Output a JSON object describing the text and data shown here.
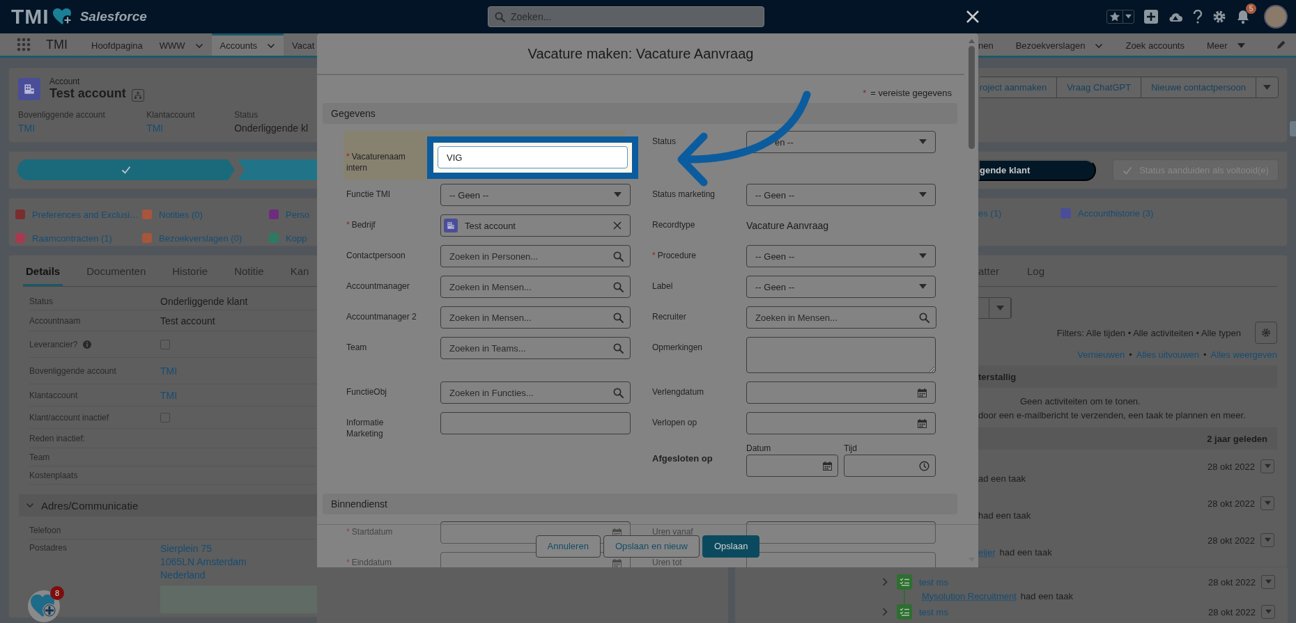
{
  "header": {
    "logo": "TMI",
    "brand": "Salesforce",
    "search": {
      "placeholder": "Zoeken..."
    },
    "notifications": "5"
  },
  "nav_left": {
    "app": "TMI",
    "items": [
      {
        "label": "Hoofdpagina",
        "kind": "link",
        "selected": false
      },
      {
        "label": "WWW",
        "kind": "menu",
        "selected": false
      },
      {
        "label": "Accounts",
        "kind": "menu",
        "selected": true
      },
      {
        "label": "Vacat",
        "kind": "link",
        "selected": false
      }
    ]
  },
  "nav_right": {
    "items": [
      {
        "label": "nen",
        "kind": "link",
        "selected": false
      },
      {
        "label": "Bezoekverslagen",
        "kind": "menu",
        "selected": false
      },
      {
        "label": "Zoek accounts",
        "kind": "link",
        "selected": false
      },
      {
        "label": "Meer",
        "kind": "more",
        "selected": false
      }
    ]
  },
  "account": {
    "type": "Account",
    "name": "Test account",
    "fields": [
      {
        "label": "Bovenliggende account",
        "value": "TMI",
        "link": true
      },
      {
        "label": "Klantaccount",
        "value": "TMI",
        "link": true
      },
      {
        "label": "Status",
        "value": "Onderliggende kl",
        "link": false
      }
    ]
  },
  "actions": [
    {
      "label": "roject aanmaken"
    },
    {
      "label": "Vraag ChatGPT"
    },
    {
      "label": "Nieuwe contactpersoon"
    }
  ],
  "path": {
    "steps": [
      {
        "complete": true
      },
      {
        "complete": false
      }
    ],
    "buttons": [
      {
        "label": "gende klant",
        "disabled": false
      },
      {
        "label": "Status aanduiden als voltooid(e)",
        "disabled": true
      }
    ]
  },
  "related": {
    "left": [
      {
        "label": "Preferences and Exclusi…",
        "color": "#7a2d2d"
      },
      {
        "label": "Notities (0)",
        "color": "#a8553c"
      },
      {
        "label": "Perso",
        "color": "#6e2c80"
      },
      {
        "label": "Raamcontracten (1)",
        "color": "#a83a50"
      },
      {
        "label": "Bezoekverslagen (0)",
        "color": "#a8553c"
      },
      {
        "label": "Kopp",
        "color": "#2c7a62"
      }
    ],
    "right": [
      {
        "label": "es (1)"
      },
      {
        "label": "Accounthistorie (3)",
        "color": "#4a4e98"
      }
    ]
  },
  "details": {
    "tabs": [
      {
        "label": "Details",
        "selected": true
      },
      {
        "label": "Documenten",
        "selected": false
      },
      {
        "label": "Historie",
        "selected": false
      },
      {
        "label": "Notitie",
        "selected": false
      },
      {
        "label": "Kan",
        "selected": false
      }
    ],
    "rows": [
      {
        "label": "Status",
        "kind": "text",
        "value": "Onderliggende klant"
      },
      {
        "label": "Accountnaam",
        "kind": "text",
        "value": "Test account"
      },
      {
        "label": "Leverancier?",
        "kind": "checkbox",
        "checked": false,
        "info": true
      },
      {
        "label": "Bovenliggende account",
        "kind": "link",
        "value": "TMI"
      },
      {
        "label": "Klantaccount",
        "kind": "link",
        "value": "TMI"
      },
      {
        "label": "Klant/account inactief",
        "kind": "checkbox",
        "checked": false
      },
      {
        "label": "Reden inactief:",
        "kind": "text"
      },
      {
        "label": "Team",
        "kind": "text"
      },
      {
        "label": "Kostenplaats",
        "kind": "text"
      }
    ],
    "section": {
      "label": "Adres/Communicatie",
      "expanded": true
    },
    "address_rows": [
      {
        "label": "Telefoon",
        "kind": "text"
      },
      {
        "label": "Postadres",
        "kind": "address",
        "lines": [
          "Sierplein 75",
          "1065LN Amsterdam",
          "Nederland"
        ]
      }
    ]
  },
  "activity": {
    "tabs": [
      {
        "label": "atter",
        "selected": false
      },
      {
        "label": "Log",
        "selected": false
      }
    ],
    "filters": "Filters: Alle tijden • Alle activiteiten • Alle typen",
    "link_row": [
      {
        "kind": "link",
        "text": "Vernieuwen"
      },
      {
        "kind": "sep",
        "text": "•"
      },
      {
        "kind": "link",
        "text": "Alles uitvouwen"
      },
      {
        "kind": "sep",
        "text": "•"
      },
      {
        "kind": "link",
        "text": "Alles weergeven"
      }
    ],
    "overdue": {
      "title": "terstallig",
      "empty": "Geen activiteiten om te tonen.",
      "hint": "door een e-mailbericht te verzenden, een taak te plannen en meer."
    },
    "past": {
      "title": "2 jaar geleden",
      "items": [
        {
          "date": "28 okt 2022",
          "parts": [
            {
              "kind": "text",
              "text": "ad een taak"
            }
          ]
        },
        {
          "date": "28 okt 2022",
          "parts": [
            {
              "kind": "text",
              "text": "had een taak"
            }
          ]
        },
        {
          "date": "28 okt 2022",
          "parts": [
            {
              "kind": "link",
              "text": "eijer"
            },
            {
              "kind": "text",
              "text": "had een taak"
            }
          ]
        },
        {
          "date": "28 okt 2022",
          "title": "test ms",
          "parts": [
            {
              "kind": "link",
              "text": "Mysolution Recruitment"
            },
            {
              "kind": "text",
              "text": "had een taak"
            }
          ]
        },
        {
          "date": "28 okt 2022",
          "title": "test ms"
        }
      ]
    }
  },
  "modal": {
    "title": "Vacature maken: Vacature Aanvraag",
    "legend": {
      "mark": "*",
      "text": "= vereiste gegevens"
    },
    "sections": [
      {
        "title": "Gegevens",
        "rows": [
          [
            {
              "kind": "text",
              "label": "Vacaturenaam intern",
              "mark": "*",
              "value": "VIG",
              "highlighted": true
            },
            {
              "kind": "select",
              "label": "Status",
              "value": "en --"
            }
          ],
          [
            {
              "kind": "select",
              "label": "Functie TMI",
              "value": "-- Geen --"
            },
            {
              "kind": "select",
              "label": "Status marketing",
              "value": "-- Geen --"
            }
          ],
          [
            {
              "kind": "pill",
              "label": "Bedrijf",
              "mark": "*",
              "value": "Test account"
            },
            {
              "kind": "readonly",
              "label": "Recordtype",
              "value": "Vacature Aanvraag"
            }
          ],
          [
            {
              "kind": "lookup",
              "label": "Contactpersoon",
              "placeholder": "Zoeken in Personen..."
            },
            {
              "kind": "select",
              "label": "Procedure",
              "mark": "*",
              "value": "-- Geen --"
            }
          ],
          [
            {
              "kind": "lookup",
              "label": "Accountmanager",
              "placeholder": "Zoeken in Mensen..."
            },
            {
              "kind": "select",
              "label": "Label",
              "value": "-- Geen --"
            }
          ],
          [
            {
              "kind": "lookup",
              "label": "Accountmanager 2",
              "placeholder": "Zoeken in Mensen..."
            },
            {
              "kind": "lookup",
              "label": "Recruiter",
              "placeholder": "Zoeken in Mensen..."
            }
          ],
          [
            {
              "kind": "lookup",
              "label": "Team",
              "placeholder": "Zoeken in Teams..."
            },
            {
              "kind": "textarea",
              "label": "Opmerkingen"
            }
          ],
          [
            {
              "kind": "lookup",
              "label": "FunctieObj",
              "placeholder": "Zoeken in Functies..."
            },
            {
              "kind": "date",
              "label": "Verlengdatum"
            }
          ],
          [
            {
              "kind": "text",
              "label": "Informatie Marketing"
            },
            {
              "kind": "date",
              "label": "Verlopen op"
            }
          ],
          [
            null,
            {
              "kind": "datetime",
              "label": "Afgesloten op",
              "date_label": "Datum",
              "time_label": "Tijd"
            }
          ]
        ]
      },
      {
        "title": "Binnendienst",
        "rows": [
          [
            {
              "kind": "date",
              "label": "Startdatum",
              "mark": "*"
            },
            {
              "kind": "text",
              "label": "Uren vanaf"
            }
          ],
          [
            {
              "kind": "date",
              "label": "Einddatum",
              "mark": "*"
            },
            {
              "kind": "text",
              "label": "Uren tot"
            }
          ]
        ]
      }
    ],
    "buttons": [
      {
        "label": "Annuleren",
        "kind": "neutral"
      },
      {
        "label": "Opslaan en nieuw",
        "kind": "neutral"
      },
      {
        "label": "Opslaan",
        "kind": "brand"
      }
    ]
  },
  "floating_badge": {
    "count": "8"
  }
}
